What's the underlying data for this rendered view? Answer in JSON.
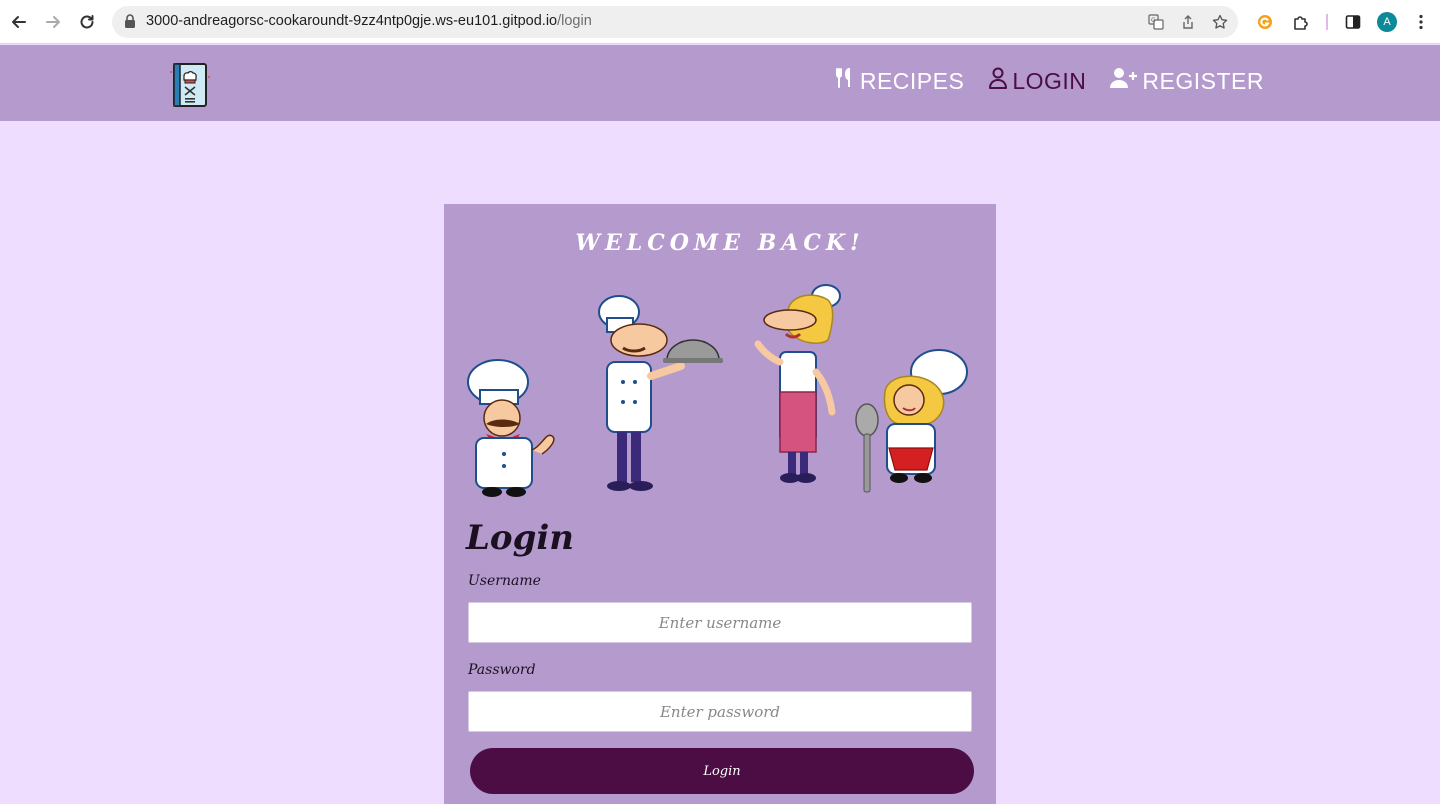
{
  "browser": {
    "url_host": "3000-andreagorsc-cookaroundt-9zz4ntp0gje.ws-eu101.gitpod.io",
    "url_path": "/login",
    "avatar_letter": "A",
    "icons": [
      "back-icon",
      "forward-icon",
      "reload-icon",
      "lock-icon",
      "translate-icon",
      "share-icon",
      "bookmark-star-icon",
      "extension-g-icon",
      "extensions-puzzle-icon",
      "side-panel-icon",
      "menu-dots-icon"
    ]
  },
  "header": {
    "logo_icon": "chef-book-logo",
    "nav": [
      {
        "label": "Recipes",
        "icon": "utensils-icon"
      },
      {
        "label": "Login",
        "icon": "user-icon"
      },
      {
        "label": "Register",
        "icon": "user-plus-icon"
      }
    ],
    "colors": {
      "background": "#b59acd",
      "active_link": "#4b0d44",
      "link": "#ffffff"
    }
  },
  "card": {
    "welcome": "WELCOME BACK!",
    "illustration": "four-cartoon-chefs",
    "form_title": "Login",
    "username_label": "Username",
    "username_placeholder": "Enter username",
    "password_label": "Password",
    "password_placeholder": "Enter password",
    "submit_label": "Login"
  },
  "colors": {
    "page_bg": "#eeddfe",
    "card_bg": "#b59acd",
    "button_bg": "#4b0d44"
  }
}
